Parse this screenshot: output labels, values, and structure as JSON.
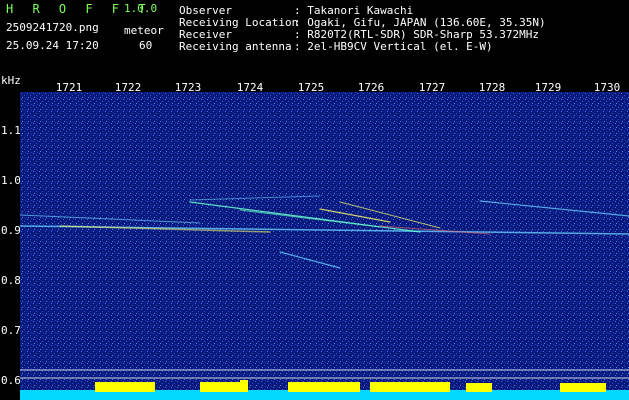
{
  "header": {
    "brand": "H R O F F T",
    "version": "1.0.0",
    "filename": "2509241720.png",
    "mode": "meteor",
    "datetime": "25.09.24 17:20",
    "count": "60",
    "fields": [
      {
        "label": "Observer",
        "value": ": Takanori Kawachi"
      },
      {
        "label": "Receiving Location",
        "value": ": Ogaki, Gifu, JAPAN (136.60E, 35.35N)"
      },
      {
        "label": "Receiver",
        "value": ": R820T2(RTL-SDR) SDR-Sharp 53.372MHz"
      },
      {
        "label": "Receiving antenna",
        "value": ": 2el-HB9CV Vertical (el. E-W)"
      }
    ]
  },
  "axis": {
    "unit": "kHz",
    "x_ticks": [
      "1721",
      "1722",
      "1723",
      "1724",
      "1725",
      "1726",
      "1727",
      "1728",
      "1729",
      "1730"
    ],
    "y_ticks": [
      "1.1",
      "1.0",
      "0.9",
      "0.8",
      "0.7",
      "0.6"
    ]
  },
  "colors": {
    "background": "#0a1a7a",
    "trace": "#ffff66",
    "bottom_bar": "#00d8ff",
    "bottom_peak": "#ffff00"
  }
}
